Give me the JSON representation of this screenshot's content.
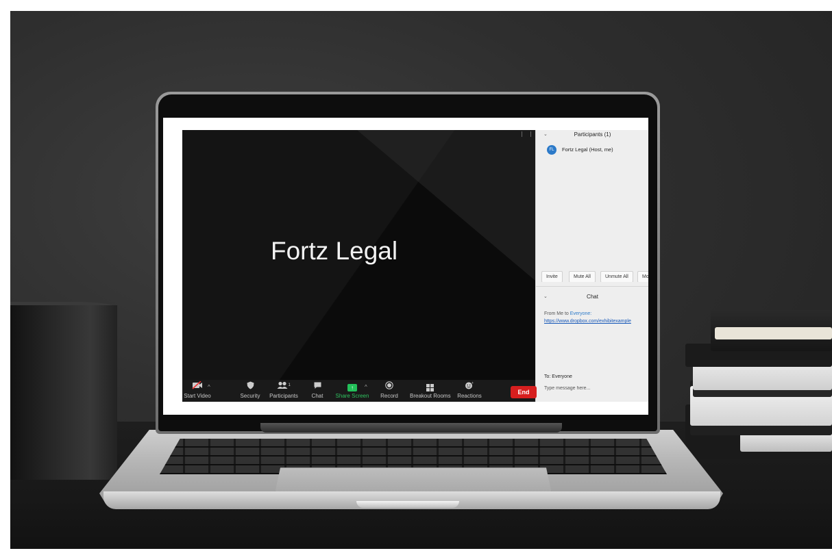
{
  "video": {
    "host_name": "Fortz Legal"
  },
  "toolbar": {
    "start_video": "Start Video",
    "security": "Security",
    "participants": "Participants",
    "participants_count": "1",
    "chat": "Chat",
    "share_screen": "Share Screen",
    "record": "Record",
    "breakout_rooms": "Breakout Rooms",
    "reactions": "Reactions",
    "end": "End"
  },
  "participants_panel": {
    "title": "Participants (1)",
    "participant": {
      "initials": "FL",
      "name": "Fortz Legal (Host, me)"
    },
    "buttons": {
      "invite": "Invite",
      "mute_all": "Mute All",
      "unmute_all": "Unmute All",
      "more": "Mo"
    }
  },
  "chat_panel": {
    "title": "Chat",
    "from_prefix": "From Me to ",
    "to_name": "Everyone:",
    "message_link": "https://www.dropbox.com/exhibitexample",
    "recipient": "To: Everyone",
    "input_placeholder": "Type message here..."
  },
  "colors": {
    "share_green": "#23c15a",
    "end_red": "#d71f1f",
    "link_blue": "#1557b8",
    "avatar_blue": "#2c7ac9"
  }
}
